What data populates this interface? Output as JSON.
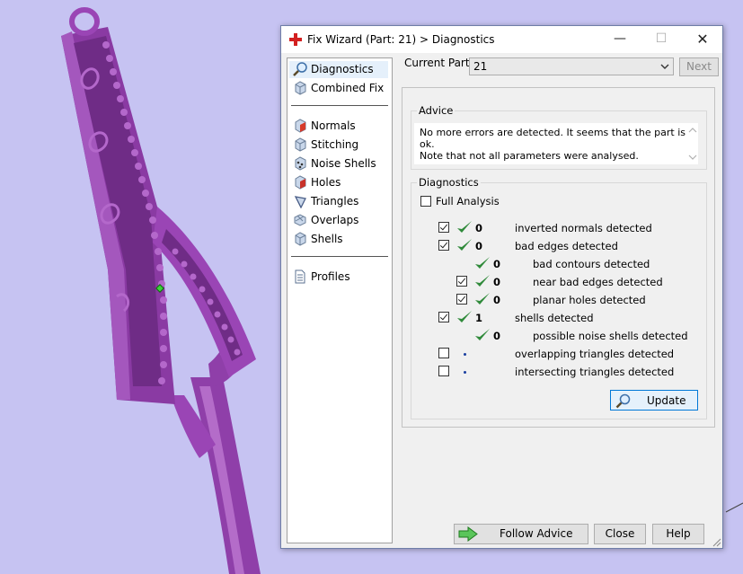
{
  "window": {
    "title": "Fix Wizard (Part: 21) > Diagnostics",
    "minimize": "—",
    "maximize": "☐",
    "close": "✕"
  },
  "nav": {
    "items": [
      {
        "label": "Diagnostics",
        "icon": "magnifier-icon"
      },
      {
        "label": "Combined Fix",
        "icon": "cube-icon"
      },
      {
        "label": "Normals",
        "icon": "normals-cube-icon"
      },
      {
        "label": "Stitching",
        "icon": "stitching-cube-icon"
      },
      {
        "label": "Noise Shells",
        "icon": "noise-shells-icon"
      },
      {
        "label": "Holes",
        "icon": "holes-cube-icon"
      },
      {
        "label": "Triangles",
        "icon": "triangles-icon"
      },
      {
        "label": "Overlaps",
        "icon": "overlaps-icon"
      },
      {
        "label": "Shells",
        "icon": "shells-cube-icon"
      },
      {
        "label": "Profiles",
        "icon": "document-icon"
      }
    ]
  },
  "current_part": {
    "label": "Current Part:",
    "value": "21",
    "next_label": "Next"
  },
  "advice": {
    "legend": "Advice",
    "line1": "No more errors are detected. It seems that the part is ok.",
    "line2": "Note that not all parameters were analysed."
  },
  "diagnostics": {
    "legend": "Diagnostics",
    "full_analysis_label": "Full Analysis",
    "full_analysis_checked": false,
    "rows": [
      {
        "checked": true,
        "status": "ok",
        "count": "0",
        "label": "inverted normals detected"
      },
      {
        "checked": true,
        "status": "ok",
        "count": "0",
        "label": "bad edges detected"
      },
      {
        "checked": null,
        "status": "ok",
        "count": "0",
        "label": "bad contours detected"
      },
      {
        "checked": true,
        "status": "ok",
        "count": "0",
        "label": "near bad edges detected"
      },
      {
        "checked": true,
        "status": "ok",
        "count": "0",
        "label": "planar holes detected"
      },
      {
        "checked": true,
        "status": "ok",
        "count": "1",
        "label": "shells detected"
      },
      {
        "checked": null,
        "status": "ok",
        "count": "0",
        "label": "possible noise shells detected"
      },
      {
        "checked": false,
        "status": "pending",
        "count": "",
        "label": "overlapping triangles detected"
      },
      {
        "checked": false,
        "status": "pending",
        "count": "",
        "label": "intersecting triangles detected"
      }
    ],
    "update_label": "Update"
  },
  "footer": {
    "follow_advice_label": "Follow Advice",
    "close_label": "Close",
    "help_label": "Help"
  },
  "colors": {
    "background": "#c6c3f2",
    "model": "#9a45b5",
    "check_green": "#2f8a3a",
    "accent_blue": "#0078d7"
  }
}
